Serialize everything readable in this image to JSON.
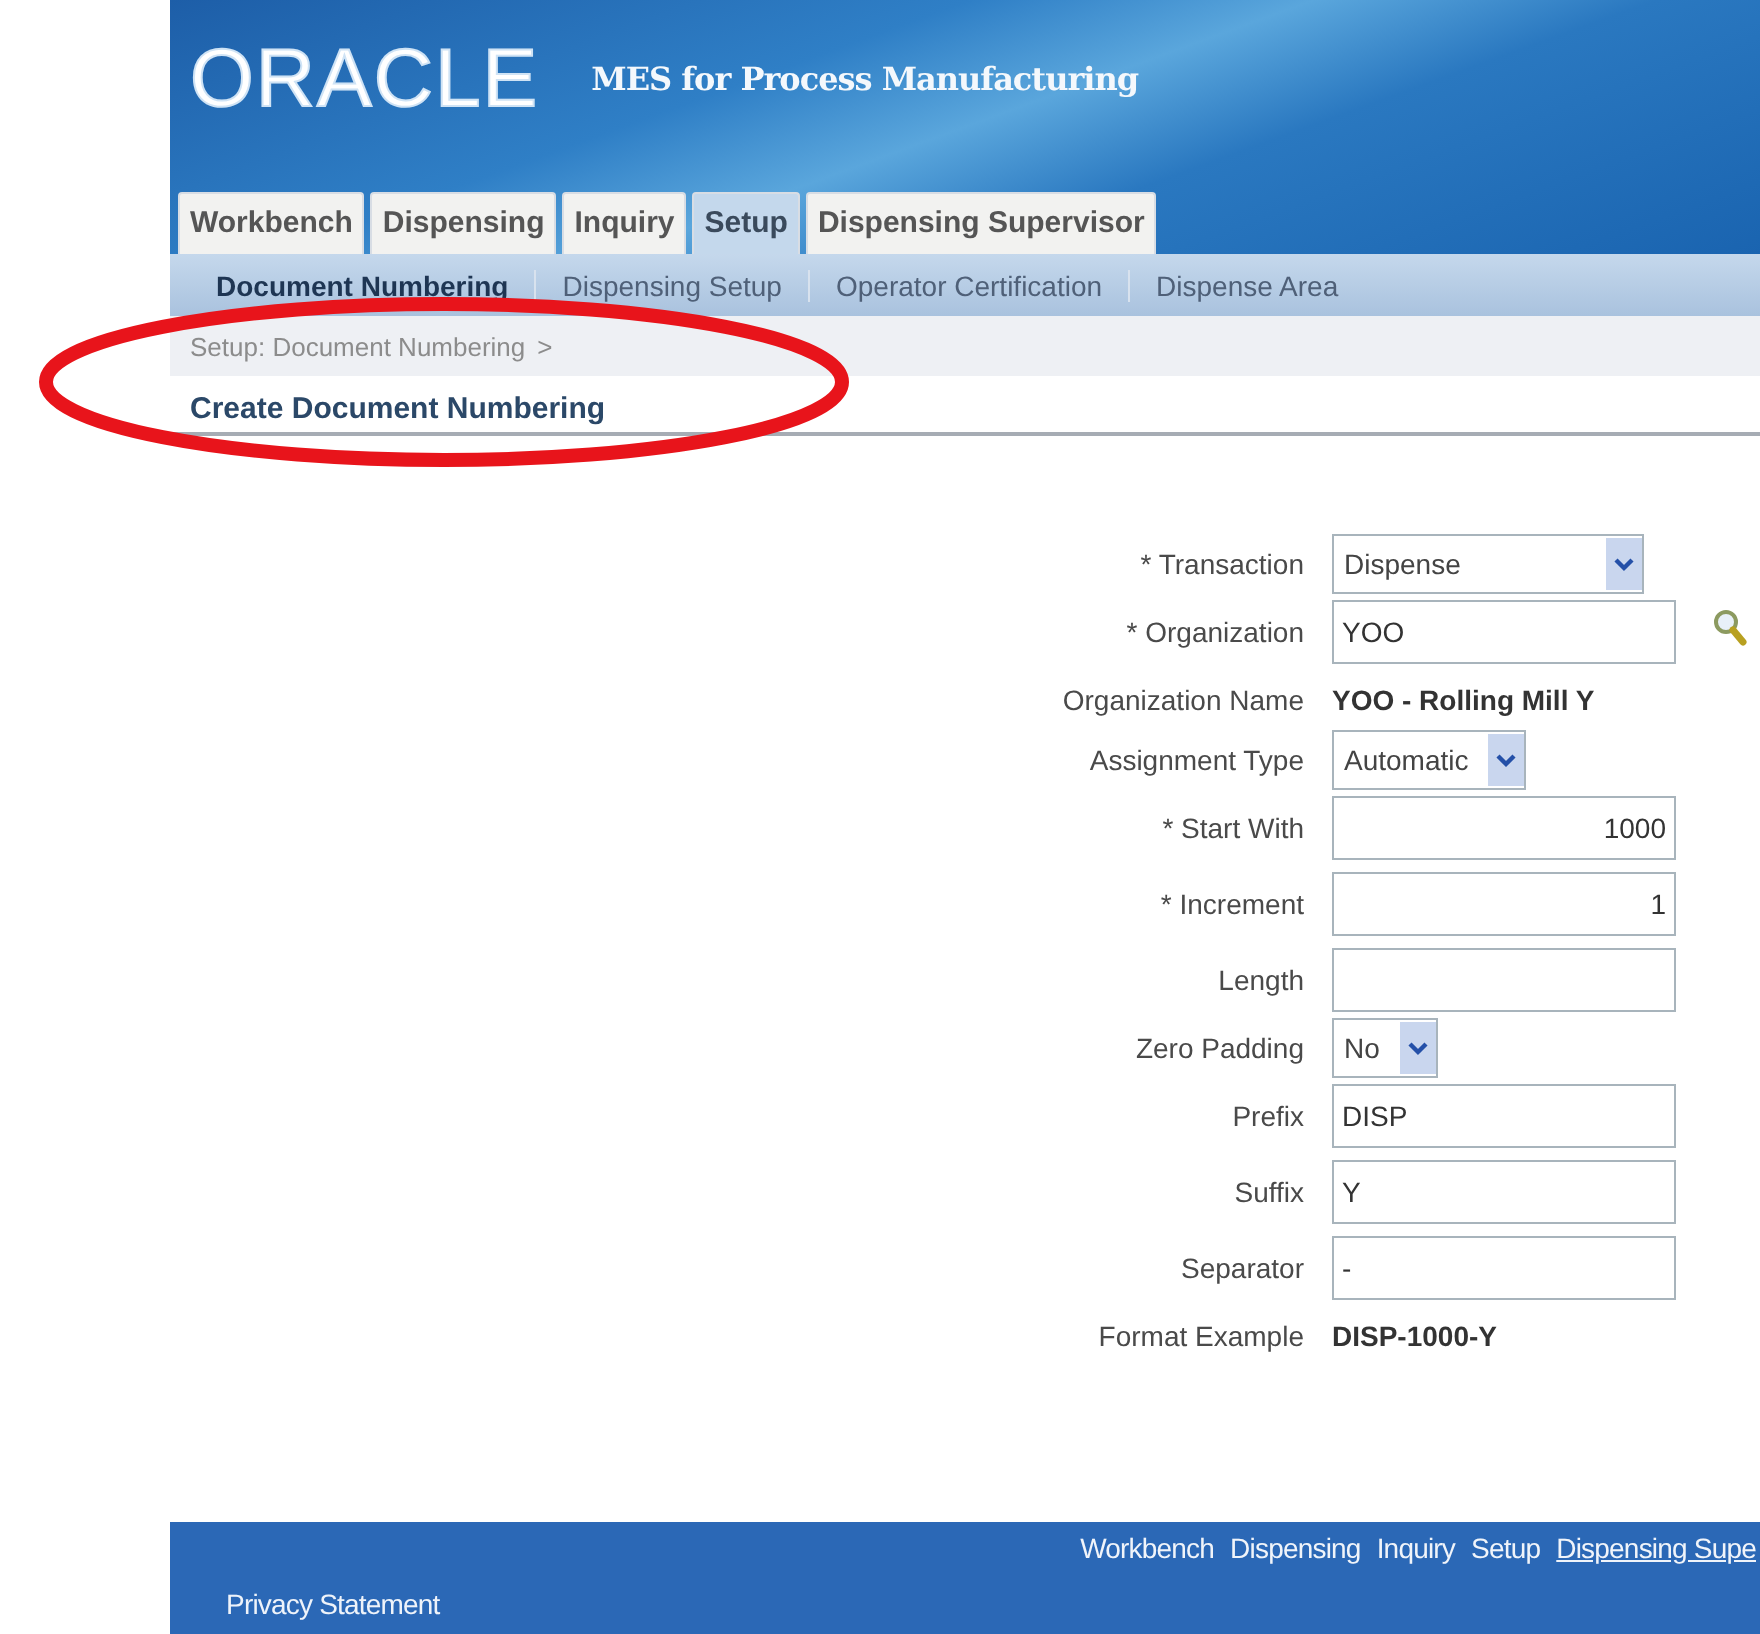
{
  "header": {
    "logo": "ORACLE",
    "product": "MES for Process Manufacturing"
  },
  "tabs": [
    {
      "label": "Workbench",
      "selected": false
    },
    {
      "label": "Dispensing",
      "selected": false
    },
    {
      "label": "Inquiry",
      "selected": false
    },
    {
      "label": "Setup",
      "selected": true
    },
    {
      "label": "Dispensing Supervisor",
      "selected": false
    }
  ],
  "subtabs": [
    {
      "label": "Document Numbering",
      "selected": true
    },
    {
      "label": "Dispensing Setup",
      "selected": false
    },
    {
      "label": "Operator Certification",
      "selected": false
    },
    {
      "label": "Dispense Area",
      "selected": false
    }
  ],
  "breadcrumb": {
    "link": "Setup: Document Numbering",
    "separator": ">"
  },
  "page_title": "Create Document Numbering",
  "form": {
    "fields": [
      {
        "kind": "select",
        "label": "* Transaction",
        "value": "Dispense"
      },
      {
        "kind": "lookup",
        "label": "* Organization",
        "value": "YOO"
      },
      {
        "kind": "display",
        "label": "Organization Name",
        "value": "YOO - Rolling Mill Y"
      },
      {
        "kind": "select",
        "label": "Assignment Type",
        "value": "Automatic"
      },
      {
        "kind": "number",
        "label": "* Start With",
        "value": "1000"
      },
      {
        "kind": "number",
        "label": "* Increment",
        "value": "1"
      },
      {
        "kind": "text",
        "label": "Length"
      },
      {
        "kind": "select",
        "label": "Zero Padding",
        "value": "No"
      },
      {
        "kind": "text",
        "label": "Prefix",
        "value": "DISP"
      },
      {
        "kind": "text",
        "label": "Suffix",
        "value": "Y"
      },
      {
        "kind": "text",
        "label": "Separator",
        "value": "-"
      },
      {
        "kind": "display",
        "label": "Format Example",
        "value": "DISP-1000-Y"
      }
    ]
  },
  "footer": {
    "links": [
      {
        "label": "Workbench",
        "underlined": false
      },
      {
        "label": "Dispensing",
        "underlined": false
      },
      {
        "label": "Inquiry",
        "underlined": false
      },
      {
        "label": "Setup",
        "underlined": false
      },
      {
        "label": "Dispensing Supe",
        "underlined": true
      }
    ],
    "privacy": "Privacy Statement"
  }
}
